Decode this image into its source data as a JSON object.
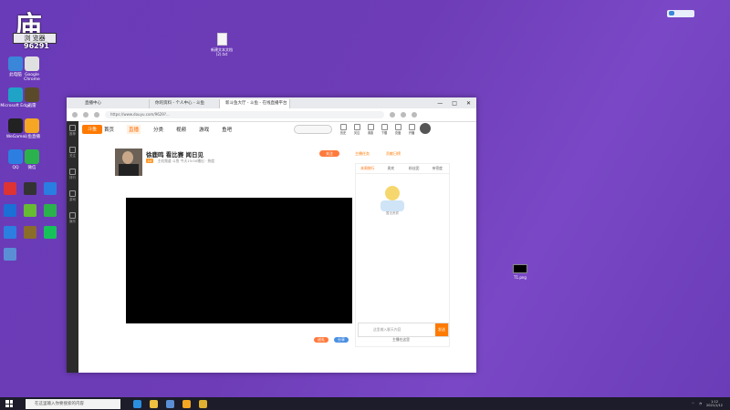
{
  "overlay": {
    "char": "庙",
    "label": "浏 览器",
    "number": "96291"
  },
  "desktop_icons": [
    {
      "label": "此电脑",
      "color": "#3a86d9"
    },
    {
      "label": "Google Chrome",
      "color": "#e0e0e0"
    },
    {
      "label": "Microsoft Edge",
      "color": "#1fa3c7"
    },
    {
      "label": "迅雷",
      "color": "#5a4a2a"
    },
    {
      "label": "WeGame",
      "color": "#222"
    },
    {
      "label": "斗鱼直播",
      "color": "#f5a623"
    },
    {
      "label": "QQ",
      "color": "#2c7fe0"
    },
    {
      "label": "微信",
      "color": "#2bb24c"
    }
  ],
  "desktop_file_top": "新建文本文档(2).txt",
  "desktop_file_right": "T1.png",
  "browser": {
    "tabs": [
      "直播中心",
      "你的资料 - 个人中心 - 斗鱼",
      "新斗鱼大厅 - 斗鱼 - 在线直播平台"
    ],
    "address": "https://www.douyu.com/9629?...",
    "window_controls": [
      "—",
      "□",
      "✕"
    ]
  },
  "site": {
    "logo": "斗鱼",
    "nav": [
      "首页",
      "直播",
      "分类",
      "视频",
      "游戏",
      "鱼吧"
    ],
    "nav_active_index": 1,
    "header_icons": [
      "历史",
      "关注",
      "消息",
      "下载",
      "充值",
      "开播"
    ],
    "sidebar": [
      "推荐",
      "关注",
      "排行",
      "游戏",
      "娱乐"
    ]
  },
  "streamer": {
    "title": "徐鹿鸣 看比赛 闻日见",
    "meta": "主机频道  斗鱼  今天15:00播出  ·  热度",
    "badge": "LV",
    "follow": "关注"
  },
  "player_footer": {
    "orange_btn": "送礼",
    "blue_btn": "分享"
  },
  "right_panel": {
    "top_links": [
      "主播任务",
      "贡献日榜"
    ],
    "tabs": [
      "本周排行",
      "贵宾",
      "粉丝团",
      "亲密度"
    ],
    "mascot_caption": "暂无贵宾",
    "chat_placeholder": "这里输入聊天内容",
    "send": "发送",
    "bottom_link": "主播在这里"
  },
  "taskbar": {
    "search_placeholder": "在这里输入你要搜索的内容",
    "clock": "1:12",
    "date": "2021/1/12"
  }
}
